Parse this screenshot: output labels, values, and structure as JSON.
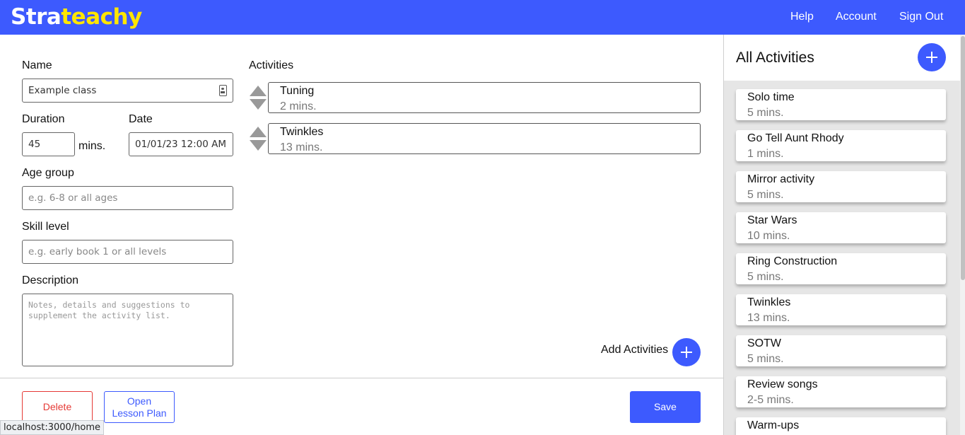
{
  "header": {
    "logo_part1": "Stra",
    "logo_part2": "teachy",
    "nav": {
      "help": "Help",
      "account": "Account",
      "sign_out": "Sign Out"
    },
    "brand_color": "#3d5afe",
    "logo_accent_color": "#ffe600"
  },
  "form": {
    "name_label": "Name",
    "name_value": "Example class",
    "duration_label": "Duration",
    "duration_value": "45",
    "duration_unit": "mins.",
    "date_label": "Date",
    "date_value": "01/01/23 12:00 AM",
    "age_label": "Age group",
    "age_placeholder": "e.g. 6-8 or all ages",
    "skill_label": "Skill level",
    "skill_placeholder": "e.g. early book 1 or all levels",
    "desc_label": "Description",
    "desc_placeholder": "Notes, details and suggestions to supplement the activity list."
  },
  "activities": {
    "label": "Activities",
    "items": [
      {
        "name": "Tuning",
        "duration": "2 mins."
      },
      {
        "name": "Twinkles",
        "duration": "13 mins."
      }
    ],
    "add_label": "Add Activities"
  },
  "footer": {
    "delete": "Delete",
    "open_line1": "Open",
    "open_line2": "Lesson Plan",
    "save": "Save",
    "status_url": "localhost:3000/home"
  },
  "sidebar": {
    "title": "All Activities",
    "items": [
      {
        "name": "Solo time",
        "duration": "5 mins."
      },
      {
        "name": "Go Tell Aunt Rhody",
        "duration": "1 mins."
      },
      {
        "name": "Mirror activity",
        "duration": "5 mins."
      },
      {
        "name": "Star Wars",
        "duration": "10 mins."
      },
      {
        "name": "Ring Construction",
        "duration": "5 mins."
      },
      {
        "name": "Twinkles",
        "duration": "13 mins."
      },
      {
        "name": "SOTW",
        "duration": "5 mins."
      },
      {
        "name": "Review songs",
        "duration": "2-5 mins."
      },
      {
        "name": "Warm-ups",
        "duration": ""
      }
    ]
  }
}
